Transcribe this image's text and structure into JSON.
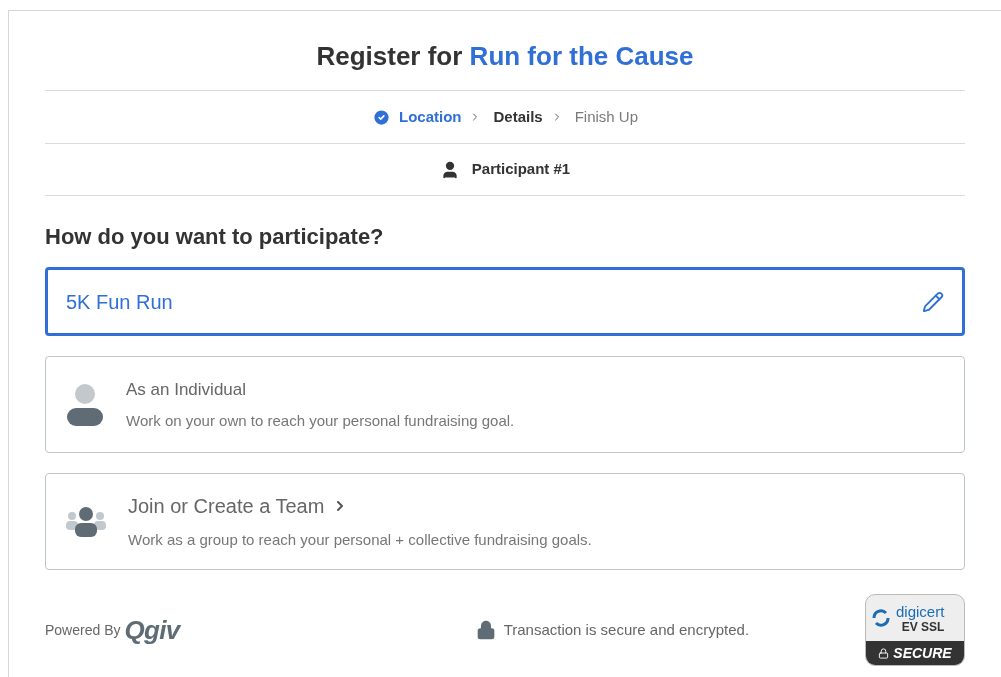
{
  "title": {
    "prefix": "Register for",
    "event": "Run for the Cause"
  },
  "steps": [
    {
      "label": "Location",
      "completed": true,
      "selected": false
    },
    {
      "label": "Details",
      "completed": false,
      "selected": true
    },
    {
      "label": "Finish Up",
      "completed": false,
      "selected": false
    }
  ],
  "participant": "Participant #1",
  "question": "How do you want to participate?",
  "selected_event": "5K Fun Run",
  "options": [
    {
      "kind": "individual",
      "title": "As an Individual",
      "description": "Work on your own to reach your personal fundraising goal.",
      "arrow": false
    },
    {
      "kind": "team",
      "title": "Join or Create a Team",
      "description": "Work as a group to reach your personal + collective fundraising goals.",
      "arrow": true
    }
  ],
  "footer": {
    "powered_by": "Powered By",
    "logo": "Qgiv",
    "security_note": "Transaction is secure and encrypted.",
    "badge": {
      "brand": "digicert",
      "level": "EV SSL",
      "status": "SECURE"
    }
  }
}
